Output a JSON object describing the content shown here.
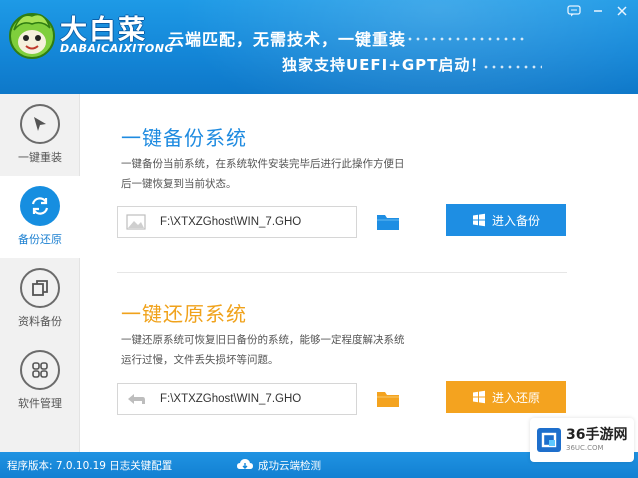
{
  "header": {
    "logo_title": "大白菜",
    "logo_subtitle": "DABAICAIXITONG",
    "slogan_line1": "云端匹配，无需技术，一键重装",
    "slogan_line2": "独家支持UEFI+GPT启动！",
    "brand_color": "#1487d8",
    "window_icons": [
      "feedback-icon",
      "minimize-icon",
      "close-icon"
    ]
  },
  "sidebar": {
    "items": [
      {
        "label": "一键重装",
        "icon": "cursor-arrow-icon",
        "active": false
      },
      {
        "label": "备份还原",
        "icon": "sync-arrows-icon",
        "active": true
      },
      {
        "label": "资料备份",
        "icon": "copy-squares-icon",
        "active": false
      },
      {
        "label": "软件管理",
        "icon": "grid-apps-icon",
        "active": false
      }
    ]
  },
  "backup": {
    "title": "一键备份系统",
    "description": "一键备份当前系统，在系统软件安装完毕后进行此操作方便日后一键恢复到当前状态。",
    "path_value": "F:\\XTXZGhost\\WIN_7.GHO",
    "button_label": "进入备份",
    "accent_color": "#1e8ee3"
  },
  "restore": {
    "title": "一键还原系统",
    "description": "一键还原系统可恢复旧日备份的系统，能够一定程度解决系统运行过慢，文件丢失损坏等问题。",
    "path_value": "F:\\XTXZGhost\\WIN_7.GHO",
    "button_label": "进入还原",
    "accent_color": "#f4a31f"
  },
  "status": {
    "version": "程序版本: 7.0.10.19 日志关键配置",
    "message": "成功云端检测"
  },
  "watermark": {
    "title": "36手游网",
    "url": "36UC.COM"
  }
}
